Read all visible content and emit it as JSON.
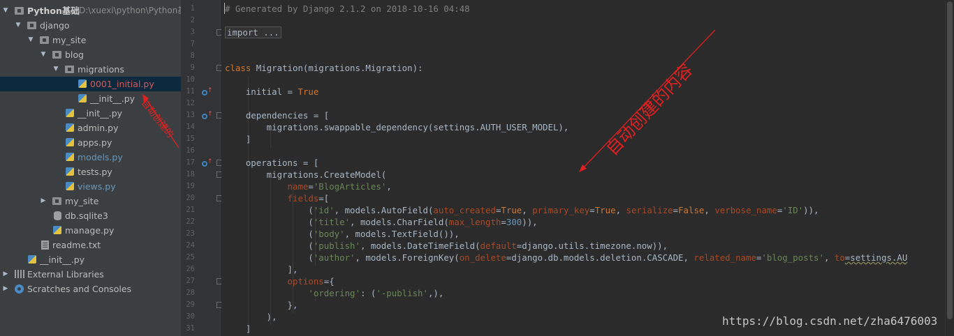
{
  "project_tree": {
    "root": {
      "label": "Python基础",
      "path": "D:\\xuexi\\python\\Python基础"
    },
    "items": [
      {
        "label": "django"
      },
      {
        "label": "my_site"
      },
      {
        "label": "blog"
      },
      {
        "label": "migrations"
      },
      {
        "label": "0001_initial.py"
      },
      {
        "label": "__init__.py"
      },
      {
        "label": "__init__.py"
      },
      {
        "label": "admin.py"
      },
      {
        "label": "apps.py"
      },
      {
        "label": "models.py"
      },
      {
        "label": "tests.py"
      },
      {
        "label": "views.py"
      },
      {
        "label": "my_site"
      },
      {
        "label": "db.sqlite3"
      },
      {
        "label": "manage.py"
      },
      {
        "label": "readme.txt"
      },
      {
        "label": "__init__.py"
      },
      {
        "label": "External Libraries"
      },
      {
        "label": "Scratches and Consoles"
      }
    ]
  },
  "gutter": {
    "line_numbers": [
      "1",
      "2",
      "3",
      "7",
      "8",
      "9",
      "10",
      "11",
      "12",
      "13",
      "14",
      "15",
      "16",
      "17",
      "18",
      "19",
      "20",
      "21",
      "22",
      "23",
      "24",
      "25",
      "26",
      "27",
      "28",
      "29",
      "30",
      "31"
    ]
  },
  "editor": {
    "l1": "# Generated by Django 2.1.2 on 2018-10-16 04:48",
    "l3_import": "import ...",
    "l9": {
      "kw": "class",
      "rest": " Migration(migrations.Migration):"
    },
    "l11": {
      "name": "    initial = ",
      "val": "True"
    },
    "l13": "    dependencies = [",
    "l14": "        migrations.swappable_dependency(settings.AUTH_USER_MODEL),",
    "l15": "    ]",
    "l17": "    operations = [",
    "l18": "        migrations.CreateModel(",
    "l19": {
      "indent": "            ",
      "param": "name",
      "eq": "=",
      "str": "'BlogArticles'",
      "tail": ","
    },
    "l20": {
      "indent": "            ",
      "param": "fields",
      "tail": "=["
    },
    "l21": {
      "indent": "                (",
      "s1": "'id'",
      "t1": ", models.AutoField(",
      "p1": "auto_created",
      "t2": "=",
      "k1": "True",
      "t3": ", ",
      "p2": "primary_key",
      "t4": "=",
      "k2": "True",
      "t5": ", ",
      "p3": "serialize",
      "t6": "=",
      "k3": "False",
      "t7": ", ",
      "p4": "verbose_name",
      "t8": "=",
      "s2": "'ID'",
      "t9": ")),"
    },
    "l22": {
      "indent": "                (",
      "s1": "'title'",
      "t1": ", models.CharField(",
      "p1": "max_length",
      "t2": "=",
      "n1": "300",
      "t3": ")),"
    },
    "l23": {
      "indent": "                (",
      "s1": "'body'",
      "t1": ", models.TextField()),"
    },
    "l24": {
      "indent": "                (",
      "s1": "'publish'",
      "t1": ", models.DateTimeField(",
      "p1": "default",
      "t2": "=django.utils.timezone.now)),"
    },
    "l25": {
      "indent": "                (",
      "s1": "'author'",
      "t1": ", models.ForeignKey(",
      "p1": "on_delete",
      "t2": "=django.db.models.deletion.CASCADE, ",
      "p2": "related_name",
      "t3": "=",
      "s2": "'blog_posts'",
      "t4": ", ",
      "p3": "to",
      "t5": "=settings.AU"
    },
    "l26": "            ],",
    "l27": {
      "indent": "            ",
      "param": "options",
      "tail": "={"
    },
    "l28": {
      "indent": "                ",
      "s1": "'ordering'",
      "t1": ": (",
      "s2": "'-publish'",
      "t2": ",),"
    },
    "l29": "            },",
    "l30": "        ),",
    "l31": "    ]"
  },
  "annotations": {
    "left_note": "自动创建的",
    "right_note": "自动创建的内容",
    "color": "#e02020"
  },
  "watermark": "https://blog.csdn.net/zha6476003",
  "colors": {
    "tree_bg": "#3c3f41",
    "editor_bg": "#2b2b2b",
    "keyword": "#cc7832",
    "string": "#6a8759",
    "param": "#aa4926",
    "comment": "#808080",
    "number": "#6897bb",
    "selection": "#0d293e"
  }
}
